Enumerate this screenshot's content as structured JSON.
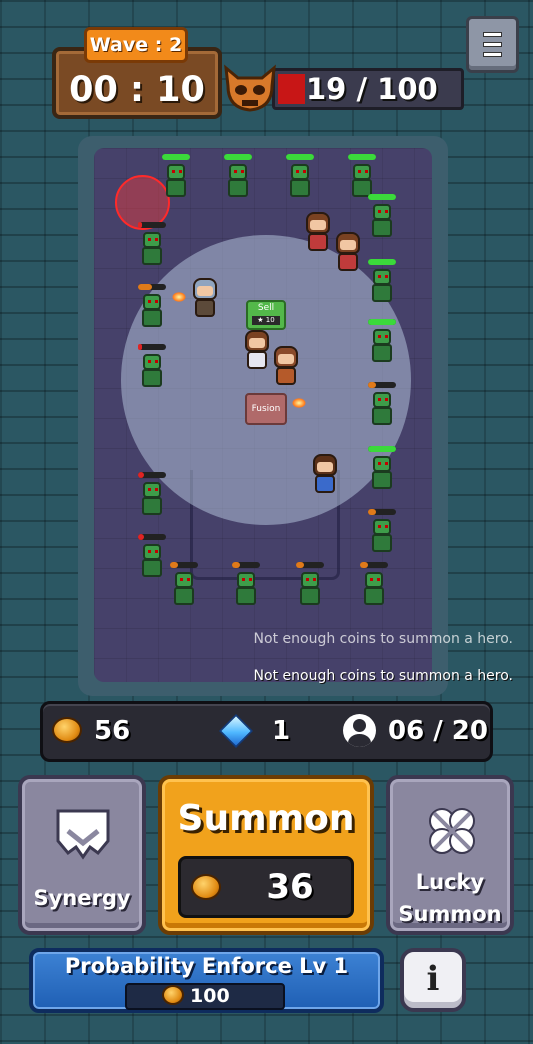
{
  "hud": {
    "wave_label": "Wave : 2",
    "timer": "00 : 10",
    "wave_progress_text": "19 / 100",
    "wave_progress_fraction": 0.19
  },
  "arena": {
    "sell_label": "Sell",
    "sell_cost": "★ 10",
    "fusion_label": "Fusion"
  },
  "messages": [
    "Not enough coins to summon a hero.",
    "Not enough coins to summon a hero."
  ],
  "resources": {
    "coins": "56",
    "gems": "1",
    "heroes": "06 / 20"
  },
  "actions": {
    "synergy_label": "Synergy",
    "summon_label": "Summon",
    "summon_cost": "36",
    "lucky_line1": "Lucky",
    "lucky_line2": "Summon",
    "probability_label": "Probability Enforce Lv 1",
    "probability_cost": "100",
    "info_label": "i"
  },
  "colors": {
    "summon": "#f1a21c",
    "probability": "#2f72c8",
    "side_button": "#8a879f",
    "hp_green": "#3bd93b",
    "wave_fill": "#c81616"
  }
}
